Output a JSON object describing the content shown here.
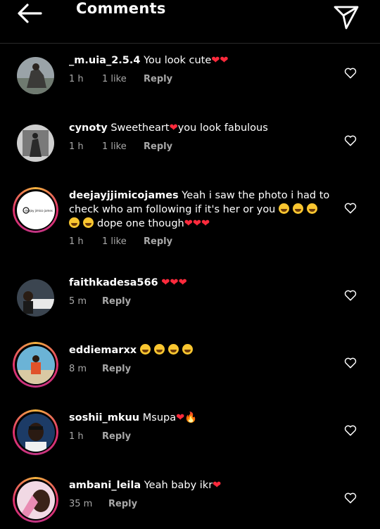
{
  "header": {
    "title": "Comments"
  },
  "comments": [
    {
      "user": "_m.uia_2.5.4",
      "text": "You look cute",
      "emoji": "❤❤",
      "time": "1 h",
      "likes": "1 like",
      "reply": "Reply"
    },
    {
      "user": "cynoty",
      "text": "Sweetheart",
      "emoji": "❤",
      "text2": "you look fabulous",
      "time": "1 h",
      "likes": "1 like",
      "reply": "Reply"
    },
    {
      "user": "deejayjjimicojames",
      "text": "Yeah i saw the photo i had to check who am following if it's her or you",
      "text2": "dope one though",
      "emoji": "❤❤❤",
      "time": "1 h",
      "likes": "1 like",
      "reply": "Reply",
      "avatar_label": "deejay jimico james"
    },
    {
      "user": "faithkadesa566",
      "emoji": "❤❤❤",
      "time": "5 m",
      "reply": "Reply"
    },
    {
      "user": "eddiemarxx",
      "time": "8 m",
      "reply": "Reply"
    },
    {
      "user": "soshii_mkuu",
      "text": "Msupa",
      "emoji": "❤",
      "emoji2": "🔥",
      "time": "1 h",
      "reply": "Reply"
    },
    {
      "user": "ambani_leila",
      "text": "Yeah baby ikr",
      "emoji": "❤",
      "time": "35 m",
      "reply": "Reply"
    }
  ],
  "colors": {
    "background": "#000000",
    "meta": "#a8a8a8",
    "heart_emoji": "#ff2a3c",
    "ring_start": "#f2b33d",
    "ring_end": "#c13584"
  }
}
